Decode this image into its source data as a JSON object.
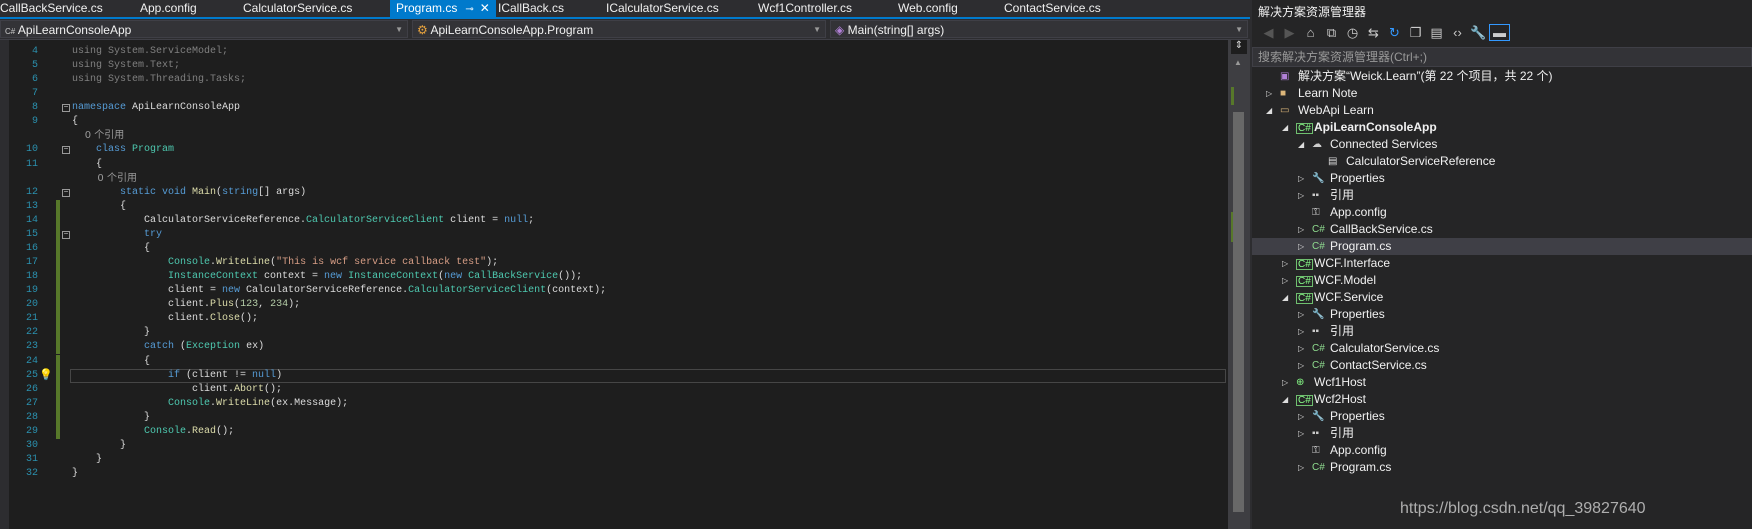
{
  "tabs": [
    {
      "label": "CallBackService.cs"
    },
    {
      "label": "App.config"
    },
    {
      "label": "CalculatorService.cs"
    },
    {
      "label": "Program.cs",
      "active": true
    },
    {
      "label": "ICallBack.cs"
    },
    {
      "label": "ICalculatorService.cs"
    },
    {
      "label": "Wcf1Controller.cs"
    },
    {
      "label": "Web.config"
    },
    {
      "label": "ContactService.cs"
    }
  ],
  "tab_controls": {
    "pin": "⊸",
    "close": "✕",
    "dropdown": "▾",
    "settings": "⚙"
  },
  "navbar": {
    "project": "ApiLearnConsoleApp",
    "class": "ApiLearnConsoleApp.Program",
    "member": "Main(string[] args)"
  },
  "code": [
    {
      "n": "4",
      "t": [
        [
          "using ",
          "us"
        ],
        [
          "System.ServiceModel;",
          "us"
        ]
      ]
    },
    {
      "n": "5",
      "t": [
        [
          "using ",
          "us"
        ],
        [
          "System.Text;",
          "us"
        ]
      ]
    },
    {
      "n": "6",
      "t": [
        [
          "using ",
          "us"
        ],
        [
          "System.Threading.Tasks;",
          "us"
        ]
      ]
    },
    {
      "n": "7",
      "t": []
    },
    {
      "n": "8",
      "fold": true,
      "t": [
        [
          "namespace ",
          "kw"
        ],
        [
          "ApiLearnConsoleApp",
          "pl"
        ]
      ]
    },
    {
      "n": "9",
      "t": [
        [
          "{",
          "pl"
        ]
      ]
    },
    {
      "lens": "    0 个引用"
    },
    {
      "n": "10",
      "fold": true,
      "t": [
        [
          "    class ",
          "kw"
        ],
        [
          "Program",
          "ty"
        ]
      ]
    },
    {
      "n": "11",
      "t": [
        [
          "    {",
          "pl"
        ]
      ]
    },
    {
      "lens": "        0 个引用"
    },
    {
      "n": "12",
      "fold": true,
      "t": [
        [
          "        static void ",
          "kw"
        ],
        [
          "Main",
          "me"
        ],
        [
          "(",
          "pl"
        ],
        [
          "string",
          "kw"
        ],
        [
          "[] args)",
          "pl"
        ]
      ]
    },
    {
      "n": "13",
      "chg": true,
      "t": [
        [
          "        {",
          "pl"
        ]
      ]
    },
    {
      "n": "14",
      "chg": true,
      "t": [
        [
          "            CalculatorServiceReference.",
          "pl"
        ],
        [
          "CalculatorServiceClient",
          "ty"
        ],
        [
          " client = ",
          "pl"
        ],
        [
          "null",
          "kw"
        ],
        [
          ";",
          "pl"
        ]
      ]
    },
    {
      "n": "15",
      "chg": true,
      "fold": true,
      "t": [
        [
          "            try",
          "kw"
        ]
      ]
    },
    {
      "n": "16",
      "chg": true,
      "t": [
        [
          "            {",
          "pl"
        ]
      ]
    },
    {
      "n": "17",
      "chg": true,
      "t": [
        [
          "                Console",
          "ty"
        ],
        [
          ".",
          "pl"
        ],
        [
          "WriteLine",
          "me"
        ],
        [
          "(",
          "pl"
        ],
        [
          "\"This is wcf service callback test\"",
          "st"
        ],
        [
          ");",
          "pl"
        ]
      ]
    },
    {
      "n": "18",
      "chg": true,
      "t": [
        [
          "                InstanceContext",
          "ty"
        ],
        [
          " context = ",
          "pl"
        ],
        [
          "new ",
          "kw"
        ],
        [
          "InstanceContext",
          "ty"
        ],
        [
          "(",
          "pl"
        ],
        [
          "new ",
          "kw"
        ],
        [
          "CallBackService",
          "ty"
        ],
        [
          "());",
          "pl"
        ]
      ]
    },
    {
      "n": "19",
      "chg": true,
      "t": [
        [
          "                client = ",
          "pl"
        ],
        [
          "new ",
          "kw"
        ],
        [
          "CalculatorServiceReference.",
          "pl"
        ],
        [
          "CalculatorServiceClient",
          "ty"
        ],
        [
          "(context);",
          "pl"
        ]
      ]
    },
    {
      "n": "20",
      "chg": true,
      "t": [
        [
          "                client.",
          "pl"
        ],
        [
          "Plus",
          "me"
        ],
        [
          "(",
          "pl"
        ],
        [
          "123",
          "nu"
        ],
        [
          ", ",
          "pl"
        ],
        [
          "234",
          "nu"
        ],
        [
          ");",
          "pl"
        ]
      ]
    },
    {
      "n": "21",
      "chg": true,
      "t": [
        [
          "                client.",
          "pl"
        ],
        [
          "Close",
          "me"
        ],
        [
          "();",
          "pl"
        ]
      ]
    },
    {
      "n": "22",
      "chg": true,
      "t": [
        [
          "            }",
          "pl"
        ]
      ]
    },
    {
      "n": "23",
      "chg": true,
      "t": [
        [
          "            catch ",
          "kw"
        ],
        [
          "(",
          "pl"
        ],
        [
          "Exception",
          "ty"
        ],
        [
          " ex)",
          "pl"
        ]
      ]
    },
    {
      "n": "24",
      "chg": true,
      "t": [
        [
          "            {",
          "pl"
        ]
      ]
    },
    {
      "n": "25",
      "chg": true,
      "current": true,
      "bulb": true,
      "t": [
        [
          "                if ",
          "kw"
        ],
        [
          "(client != ",
          "pl"
        ],
        [
          "null",
          "kw"
        ],
        [
          ")",
          "pl"
        ]
      ]
    },
    {
      "n": "26",
      "chg": true,
      "t": [
        [
          "                    client.",
          "pl"
        ],
        [
          "Abort",
          "me"
        ],
        [
          "();",
          "pl"
        ]
      ]
    },
    {
      "n": "27",
      "chg": true,
      "t": [
        [
          "                Console",
          "ty"
        ],
        [
          ".",
          "pl"
        ],
        [
          "WriteLine",
          "me"
        ],
        [
          "(ex.Message);",
          "pl"
        ]
      ]
    },
    {
      "n": "28",
      "chg": true,
      "t": [
        [
          "            }",
          "pl"
        ]
      ]
    },
    {
      "n": "29",
      "chg": true,
      "t": [
        [
          "            Console",
          "ty"
        ],
        [
          ".",
          "pl"
        ],
        [
          "Read",
          "me"
        ],
        [
          "();",
          "pl"
        ]
      ]
    },
    {
      "n": "30",
      "t": [
        [
          "        }",
          "pl"
        ]
      ]
    },
    {
      "n": "31",
      "t": [
        [
          "    }",
          "pl"
        ]
      ]
    },
    {
      "n": "32",
      "t": [
        [
          "}",
          "pl"
        ]
      ]
    }
  ],
  "solution_explorer": {
    "title": "解决方案资源管理器",
    "toolbar": [
      "back-icon",
      "forward-icon",
      "home-icon",
      "switch-views-icon",
      "pending-changes-icon",
      "sync-icon",
      "refresh-icon",
      "collapse-all-icon",
      "show-all-files-icon",
      "view-code-icon",
      "properties-icon",
      "preview-icon"
    ],
    "search_placeholder": "搜索解决方案资源管理器(Ctrl+;)",
    "tree": [
      {
        "label": "解决方案“Weick.Learn”(第 22 个项目，共 22 个)",
        "level": 0,
        "icon": "solution",
        "expand": ""
      },
      {
        "label": "Learn Note",
        "level": 0,
        "icon": "folder",
        "expand": "collapsed"
      },
      {
        "label": "WebApi Learn",
        "level": 0,
        "icon": "folder-open",
        "expand": "expanded"
      },
      {
        "label": "ApiLearnConsoleApp",
        "level": 1,
        "icon": "csproj",
        "expand": "expanded",
        "bold": true
      },
      {
        "label": "Connected Services",
        "level": 2,
        "icon": "connected",
        "expand": "expanded"
      },
      {
        "label": "CalculatorServiceReference",
        "level": 3,
        "icon": "service-ref",
        "expand": ""
      },
      {
        "label": "Properties",
        "level": 2,
        "icon": "wrench",
        "expand": "collapsed"
      },
      {
        "label": "引用",
        "level": 2,
        "icon": "references",
        "expand": "collapsed"
      },
      {
        "label": "App.config",
        "level": 2,
        "icon": "config",
        "expand": ""
      },
      {
        "label": "CallBackService.cs",
        "level": 2,
        "icon": "cs",
        "expand": "collapsed"
      },
      {
        "label": "Program.cs",
        "level": 2,
        "icon": "cs",
        "expand": "collapsed",
        "selected": true
      },
      {
        "label": "WCF.Interface",
        "level": 1,
        "icon": "csproj",
        "expand": "collapsed"
      },
      {
        "label": "WCF.Model",
        "level": 1,
        "icon": "csproj",
        "expand": "collapsed"
      },
      {
        "label": "WCF.Service",
        "level": 1,
        "icon": "csproj",
        "expand": "expanded"
      },
      {
        "label": "Properties",
        "level": 2,
        "icon": "wrench",
        "expand": "collapsed"
      },
      {
        "label": "引用",
        "level": 2,
        "icon": "references",
        "expand": "collapsed"
      },
      {
        "label": "CalculatorService.cs",
        "level": 2,
        "icon": "cs",
        "expand": "collapsed"
      },
      {
        "label": "ContactService.cs",
        "level": 2,
        "icon": "cs",
        "expand": "collapsed"
      },
      {
        "label": "Wcf1Host",
        "level": 1,
        "icon": "web",
        "expand": "collapsed"
      },
      {
        "label": "Wcf2Host",
        "level": 1,
        "icon": "csproj",
        "expand": "expanded"
      },
      {
        "label": "Properties",
        "level": 2,
        "icon": "wrench",
        "expand": "collapsed"
      },
      {
        "label": "引用",
        "level": 2,
        "icon": "references",
        "expand": "collapsed"
      },
      {
        "label": "App.config",
        "level": 2,
        "icon": "config",
        "expand": ""
      },
      {
        "label": "Program.cs",
        "level": 2,
        "icon": "cs",
        "expand": "collapsed"
      }
    ]
  },
  "watermark": "https://blog.csdn.net/qq_39827640"
}
